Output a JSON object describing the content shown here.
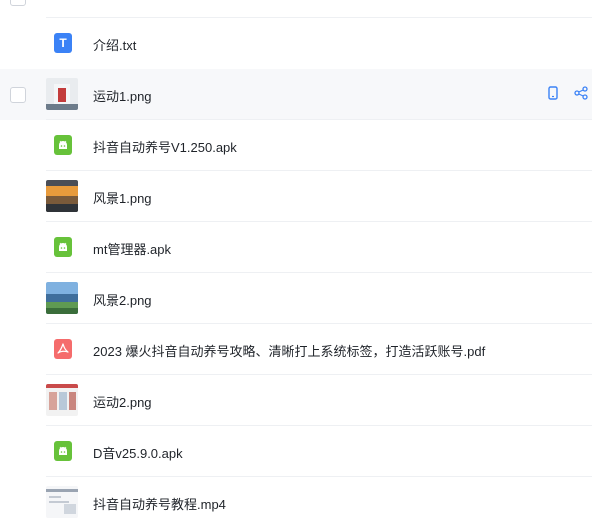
{
  "colors": {
    "accent": "#3b82f6",
    "apk_green": "#67c23a",
    "pdf_red": "#f56c6c",
    "row_hover": "#f7f8fa"
  },
  "files": [
    {
      "name": "介绍.txt",
      "type": "txt",
      "icon": "document-text-icon",
      "icon_glyph": "T"
    },
    {
      "name": "运动1.png",
      "type": "image",
      "icon": "image-thumbnail"
    },
    {
      "name": "抖音自动养号V1.250.apk",
      "type": "apk",
      "icon": "android-icon"
    },
    {
      "name": "风景1.png",
      "type": "image",
      "icon": "image-thumbnail"
    },
    {
      "name": "mt管理器.apk",
      "type": "apk",
      "icon": "android-icon"
    },
    {
      "name": "风景2.png",
      "type": "image",
      "icon": "image-thumbnail"
    },
    {
      "name": "2023 爆火抖音自动养号攻略、清晰打上系统标签，打造活跃账号.pdf",
      "type": "pdf",
      "icon": "pdf-icon"
    },
    {
      "name": "运动2.png",
      "type": "image",
      "icon": "image-thumbnail"
    },
    {
      "name": "D音v25.9.0.apk",
      "type": "apk",
      "icon": "android-icon"
    },
    {
      "name": "抖音自动养号教程.mp4",
      "type": "video",
      "icon": "video-thumbnail"
    }
  ],
  "hover_row_actions": [
    {
      "icon": "mobile-phone-icon",
      "tooltip": ""
    },
    {
      "icon": "share-icon",
      "tooltip": ""
    }
  ]
}
